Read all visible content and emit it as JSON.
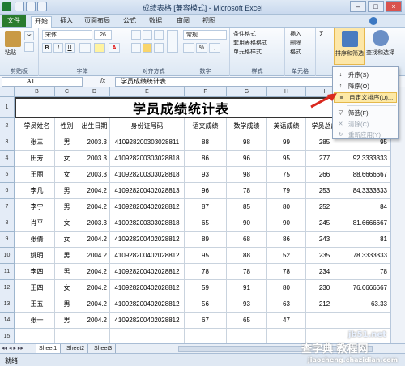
{
  "window": {
    "title": "成绩表格 [兼容模式] - Microsoft Excel"
  },
  "menu": {
    "file": "文件",
    "tabs": [
      "开始",
      "插入",
      "页面布局",
      "公式",
      "数据",
      "审阅",
      "视图"
    ]
  },
  "ribbon": {
    "paste": "粘贴",
    "font_name": "宋体",
    "font_size": "26",
    "bold": "B",
    "italic": "I",
    "underline": "U",
    "number_format": "常规",
    "cond_format": "条件格式",
    "table_format": "套用表格格式",
    "cell_style": "单元格样式",
    "insert": "插入",
    "delete": "删除",
    "format": "格式",
    "sigma": "Σ",
    "sort_filter": "排序和筛选",
    "find_select": "查找和选择",
    "groups": {
      "clipboard": "剪贴板",
      "font": "字体",
      "align": "对齐方式",
      "number": "数字",
      "style": "样式",
      "cells": "单元格"
    }
  },
  "formula": {
    "namebox": "A1",
    "fx": "fx",
    "value": "学员成绩统计表"
  },
  "columns": [
    "A",
    "B",
    "C",
    "D",
    "E",
    "F",
    "G",
    "H",
    "I",
    "J"
  ],
  "sheet": {
    "title": "学员成绩统计表",
    "headers": [
      "学员姓名",
      "性别",
      "出生日期",
      "身份证号码",
      "语文成绩",
      "数学成绩",
      "英语成绩",
      "学员总成",
      ""
    ],
    "rows": [
      [
        "张三",
        "男",
        "2003.3",
        "410928200303028811",
        "88",
        "98",
        "99",
        "285",
        "95"
      ],
      [
        "田芳",
        "女",
        "2003.3",
        "410928200303028818",
        "86",
        "96",
        "95",
        "277",
        "92.3333333"
      ],
      [
        "王丽",
        "女",
        "2003.3",
        "410928200303028818",
        "93",
        "98",
        "75",
        "266",
        "88.6666667"
      ],
      [
        "李凡",
        "男",
        "2004.2",
        "410928200402028813",
        "96",
        "78",
        "79",
        "253",
        "84.3333333"
      ],
      [
        "李宁",
        "男",
        "2004.2",
        "410928200402028812",
        "87",
        "85",
        "80",
        "252",
        "84"
      ],
      [
        "肖平",
        "女",
        "2003.3",
        "410928200303028818",
        "65",
        "90",
        "90",
        "245",
        "81.6666667"
      ],
      [
        "张倩",
        "女",
        "2004.2",
        "410928200402028812",
        "89",
        "68",
        "86",
        "243",
        "81"
      ],
      [
        "姚明",
        "男",
        "2004.2",
        "410928200402028812",
        "95",
        "88",
        "52",
        "235",
        "78.3333333"
      ],
      [
        "李四",
        "男",
        "2004.2",
        "410928200402028812",
        "78",
        "78",
        "78",
        "234",
        "78"
      ],
      [
        "王四",
        "女",
        "2004.2",
        "410928200402028812",
        "59",
        "91",
        "80",
        "230",
        "76.6666667"
      ],
      [
        "王五",
        "男",
        "2004.2",
        "410928200402028812",
        "56",
        "93",
        "63",
        "212",
        "63.33"
      ],
      [
        "张一",
        "男",
        "2004.2",
        "410928200402028812",
        "67",
        "65",
        "47",
        "",
        ""
      ]
    ],
    "row_numbers": [
      "1",
      "2",
      "3",
      "4",
      "5",
      "6",
      "7",
      "8",
      "9",
      "10",
      "11",
      "12",
      "13",
      "14",
      "15"
    ]
  },
  "dropdown": {
    "items": [
      {
        "label": "升序(S)",
        "icon": "sort-ascending-icon"
      },
      {
        "label": "降序(O)",
        "icon": "sort-descending-icon"
      },
      {
        "label": "自定义排序(U)...",
        "icon": "custom-sort-icon"
      },
      {
        "label": "筛选(F)",
        "icon": "filter-icon"
      },
      {
        "label": "清除(C)",
        "icon": "clear-icon"
      },
      {
        "label": "重新应用(Y)",
        "icon": "reapply-icon"
      }
    ]
  },
  "sheettabs": [
    "Sheet1",
    "Sheet2",
    "Sheet3"
  ],
  "status": {
    "ready": "就绪"
  },
  "watermark": {
    "line1": "jb51.net",
    "line2": "查字典 教程网",
    "line3": "jiaocheng.chazidian.com"
  },
  "colors": {
    "file_tab": "#2a7b2e",
    "highlight": "#fde9a6",
    "arrow": "#d9281e"
  }
}
